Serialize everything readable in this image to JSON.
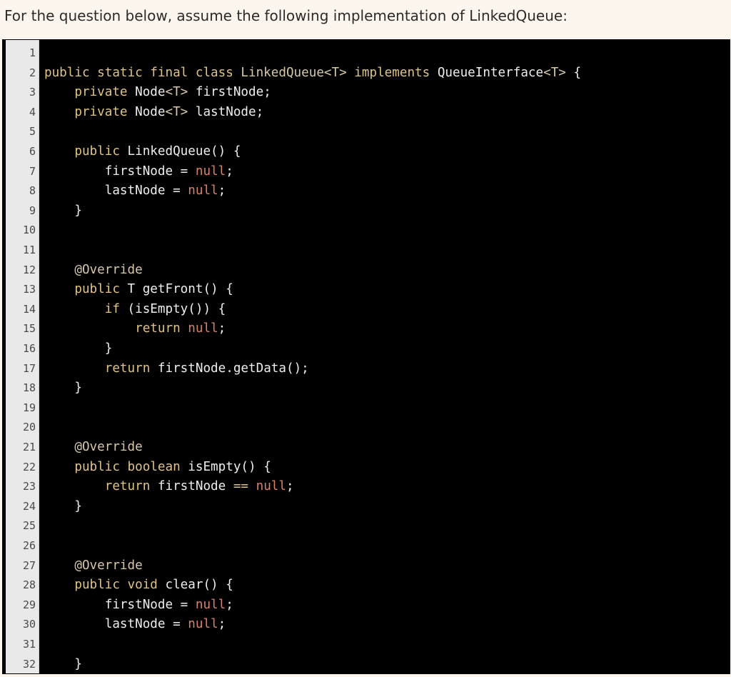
{
  "prompt": "For the question below, assume the following implementation of LinkedQueue:",
  "code": {
    "language": "java",
    "lines": [
      {
        "n": "1",
        "tokens": []
      },
      {
        "n": "2",
        "tokens": [
          {
            "t": "kw",
            "s": "public static final class "
          },
          {
            "t": "ty",
            "s": "LinkedQueue<T>"
          },
          {
            "t": "kw",
            "s": " implements "
          },
          {
            "t": "plain",
            "s": "QueueInterface"
          },
          {
            "t": "ty",
            "s": "<T>"
          },
          {
            "t": "plain",
            "s": " {"
          }
        ]
      },
      {
        "n": "3",
        "tokens": [
          {
            "t": "plain",
            "s": "    "
          },
          {
            "t": "kw",
            "s": "private "
          },
          {
            "t": "plain",
            "s": "Node"
          },
          {
            "t": "ty",
            "s": "<T>"
          },
          {
            "t": "plain",
            "s": " firstNode;"
          }
        ]
      },
      {
        "n": "4",
        "tokens": [
          {
            "t": "plain",
            "s": "    "
          },
          {
            "t": "kw",
            "s": "private "
          },
          {
            "t": "plain",
            "s": "Node"
          },
          {
            "t": "ty",
            "s": "<T>"
          },
          {
            "t": "plain",
            "s": " lastNode;"
          }
        ]
      },
      {
        "n": "5",
        "tokens": []
      },
      {
        "n": "6",
        "tokens": [
          {
            "t": "plain",
            "s": "    "
          },
          {
            "t": "kw",
            "s": "public "
          },
          {
            "t": "plain",
            "s": "LinkedQueue() {"
          }
        ]
      },
      {
        "n": "7",
        "tokens": [
          {
            "t": "plain",
            "s": "        firstNode = "
          },
          {
            "t": "lit",
            "s": "null"
          },
          {
            "t": "plain",
            "s": ";"
          }
        ]
      },
      {
        "n": "8",
        "tokens": [
          {
            "t": "plain",
            "s": "        lastNode = "
          },
          {
            "t": "lit",
            "s": "null"
          },
          {
            "t": "plain",
            "s": ";"
          }
        ]
      },
      {
        "n": "9",
        "tokens": [
          {
            "t": "plain",
            "s": "    }"
          }
        ]
      },
      {
        "n": "10",
        "tokens": []
      },
      {
        "n": "11",
        "tokens": []
      },
      {
        "n": "12",
        "tokens": [
          {
            "t": "plain",
            "s": "    "
          },
          {
            "t": "ann",
            "s": "@Override"
          }
        ]
      },
      {
        "n": "13",
        "tokens": [
          {
            "t": "plain",
            "s": "    "
          },
          {
            "t": "kw",
            "s": "public "
          },
          {
            "t": "plain",
            "s": "T getFront() {"
          }
        ]
      },
      {
        "n": "14",
        "tokens": [
          {
            "t": "plain",
            "s": "        "
          },
          {
            "t": "kw",
            "s": "if "
          },
          {
            "t": "plain",
            "s": "(isEmpty()) {"
          }
        ]
      },
      {
        "n": "15",
        "tokens": [
          {
            "t": "plain",
            "s": "            "
          },
          {
            "t": "kw",
            "s": "return "
          },
          {
            "t": "lit",
            "s": "null"
          },
          {
            "t": "plain",
            "s": ";"
          }
        ]
      },
      {
        "n": "16",
        "tokens": [
          {
            "t": "plain",
            "s": "        }"
          }
        ]
      },
      {
        "n": "17",
        "tokens": [
          {
            "t": "plain",
            "s": "        "
          },
          {
            "t": "kw",
            "s": "return "
          },
          {
            "t": "plain",
            "s": "firstNode.getData();"
          }
        ]
      },
      {
        "n": "18",
        "tokens": [
          {
            "t": "plain",
            "s": "    }"
          }
        ]
      },
      {
        "n": "19",
        "tokens": []
      },
      {
        "n": "20",
        "tokens": []
      },
      {
        "n": "21",
        "tokens": [
          {
            "t": "plain",
            "s": "    "
          },
          {
            "t": "ann",
            "s": "@Override"
          }
        ]
      },
      {
        "n": "22",
        "tokens": [
          {
            "t": "plain",
            "s": "    "
          },
          {
            "t": "kw",
            "s": "public boolean "
          },
          {
            "t": "plain",
            "s": "isEmpty() {"
          }
        ]
      },
      {
        "n": "23",
        "tokens": [
          {
            "t": "plain",
            "s": "        "
          },
          {
            "t": "kw",
            "s": "return "
          },
          {
            "t": "plain",
            "s": "firstNode "
          },
          {
            "t": "kw",
            "s": "=="
          },
          {
            "t": "plain",
            "s": " "
          },
          {
            "t": "lit",
            "s": "null"
          },
          {
            "t": "plain",
            "s": ";"
          }
        ]
      },
      {
        "n": "24",
        "tokens": [
          {
            "t": "plain",
            "s": "    }"
          }
        ]
      },
      {
        "n": "25",
        "tokens": []
      },
      {
        "n": "26",
        "tokens": []
      },
      {
        "n": "27",
        "tokens": [
          {
            "t": "plain",
            "s": "    "
          },
          {
            "t": "ann",
            "s": "@Override"
          }
        ]
      },
      {
        "n": "28",
        "tokens": [
          {
            "t": "plain",
            "s": "    "
          },
          {
            "t": "kw",
            "s": "public void "
          },
          {
            "t": "plain",
            "s": "clear() {"
          }
        ]
      },
      {
        "n": "29",
        "tokens": [
          {
            "t": "plain",
            "s": "        firstNode = "
          },
          {
            "t": "lit",
            "s": "null"
          },
          {
            "t": "plain",
            "s": ";"
          }
        ]
      },
      {
        "n": "30",
        "tokens": [
          {
            "t": "plain",
            "s": "        lastNode = "
          },
          {
            "t": "lit",
            "s": "null"
          },
          {
            "t": "plain",
            "s": ";"
          }
        ]
      },
      {
        "n": "31",
        "tokens": []
      },
      {
        "n": "32",
        "tokens": [
          {
            "t": "plain",
            "s": "    }"
          }
        ]
      }
    ]
  }
}
